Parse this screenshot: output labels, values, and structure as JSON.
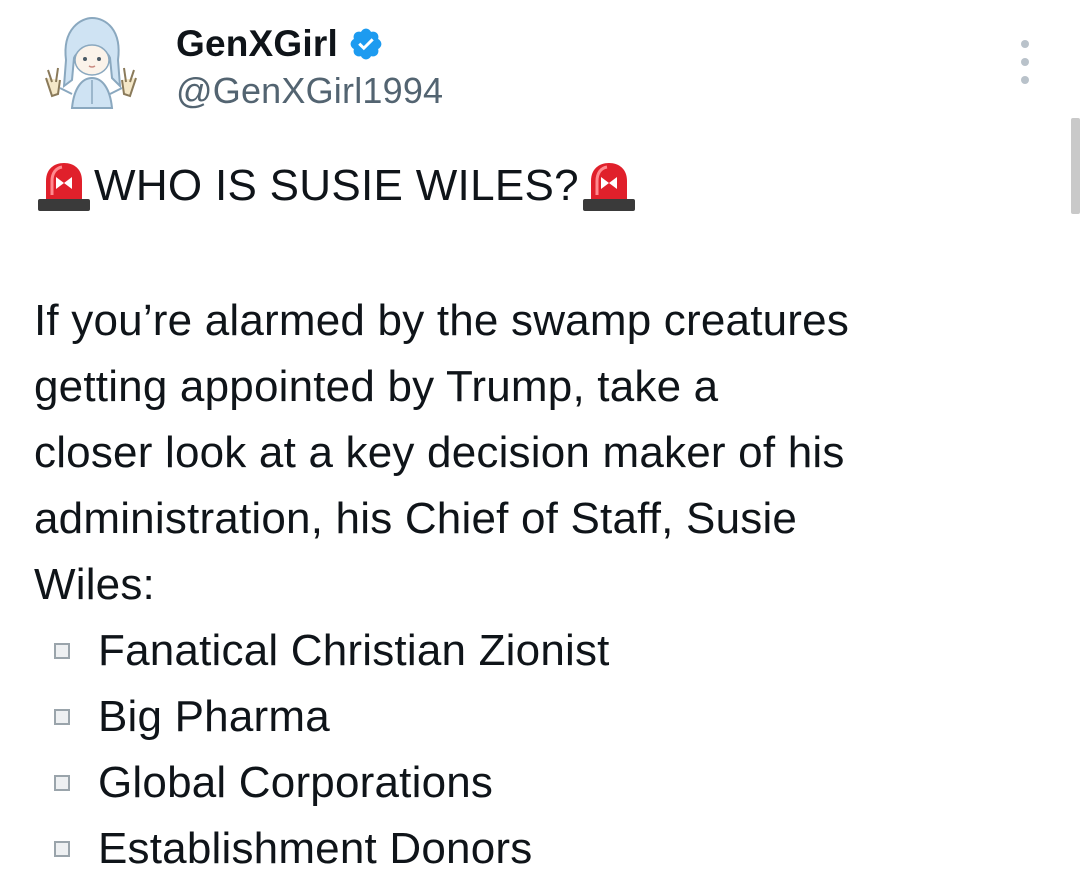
{
  "author": {
    "display_name": "GenXGirl",
    "handle": "@GenXGirl1994",
    "verified": true,
    "avatar_icon": "anime-girl-peace-sign-avatar",
    "verified_icon": "verified-badge-icon",
    "verified_color": "#1d9bf0"
  },
  "post": {
    "headline": "WHO IS SUSIE WILES?",
    "headline_icon": "police-light-emoji",
    "body": "If you’re alarmed by the swamp creatures\ngetting appointed by Trump, take a\ncloser look at a key decision maker of his\nadministration, his Chief of Staff, Susie\nWiles:",
    "bullets": [
      {
        "label": "Fanatical Christian Zionist"
      },
      {
        "label": "Big Pharma"
      },
      {
        "label": "Global Corporations"
      },
      {
        "label": "Establishment Donors"
      }
    ]
  },
  "colors": {
    "text": "#0f1419",
    "handle": "#536471",
    "siren_red": "#e0202b"
  }
}
